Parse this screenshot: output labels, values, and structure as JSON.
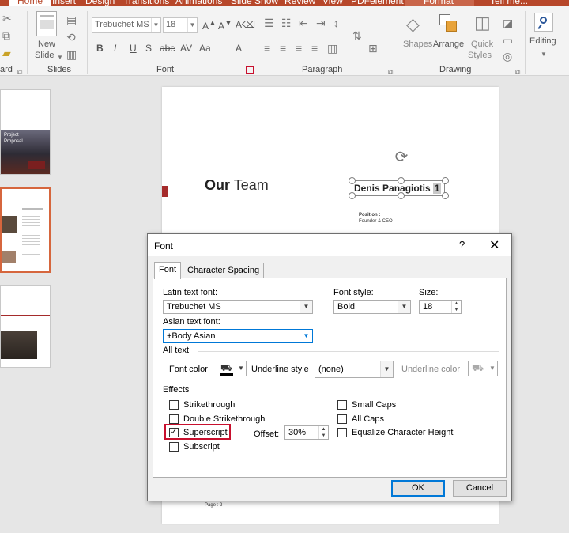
{
  "ribbon_tabs": [
    {
      "label": "Home",
      "active": true
    },
    {
      "label": "Insert"
    },
    {
      "label": "Design"
    },
    {
      "label": "Transitions"
    },
    {
      "label": "Animations"
    },
    {
      "label": "Slide Show"
    },
    {
      "label": "Review"
    },
    {
      "label": "View"
    },
    {
      "label": "PDFelement"
    },
    {
      "label": "Format"
    },
    {
      "label": "Tell me..."
    }
  ],
  "ribbon": {
    "clipboard_label": "ard",
    "new_slide_line1": "New",
    "new_slide_line2": "Slide",
    "slides_label": "Slides",
    "font_name": "Trebuchet MS",
    "font_size": "18",
    "font_label": "Font",
    "paragraph_label": "Paragraph",
    "shapes_label": "Shapes",
    "arrange_label": "Arrange",
    "quick_styles_line1": "Quick",
    "quick_styles_line2": "Styles",
    "drawing_label": "Drawing",
    "editing_label": "Editing"
  },
  "thumbnails": {
    "thumb1_line1": "Project",
    "thumb1_line2": "Proposal"
  },
  "slide": {
    "title_bold": "Our",
    "title_rest": " Team",
    "name": "Denis Panagiotis",
    "superscript_text": "1",
    "position_label": "Position    :",
    "position_value": "Founder & CEO",
    "page_label": "Page : 2"
  },
  "dialog": {
    "title": "Font",
    "help": "?",
    "close": "✕",
    "tabs": [
      "Font",
      "Character Spacing"
    ],
    "latin_font_label": "Latin text font:",
    "latin_font_value": "Trebuchet MS",
    "font_style_label": "Font style:",
    "font_style_value": "Bold",
    "size_label": "Size:",
    "size_value": "18",
    "asian_font_label": "Asian text font:",
    "asian_font_value": "+Body Asian",
    "all_text_label": "All text",
    "font_color_label": "Font color",
    "underline_style_label": "Underline style",
    "underline_style_value": "(none)",
    "underline_color_label": "Underline color",
    "effects_label": "Effects",
    "effects": {
      "strikethrough": "Strikethrough",
      "double_strikethrough": "Double Strikethrough",
      "superscript": "Superscript",
      "subscript": "Subscript",
      "small_caps": "Small Caps",
      "all_caps": "All Caps",
      "equalize": "Equalize Character Height"
    },
    "superscript_checked": true,
    "offset_label": "Offset:",
    "offset_value": "30%",
    "ok": "OK",
    "cancel": "Cancel"
  },
  "colors": {
    "accent": "#b7472a",
    "highlight": "#c8102e",
    "focus": "#0078d7"
  }
}
